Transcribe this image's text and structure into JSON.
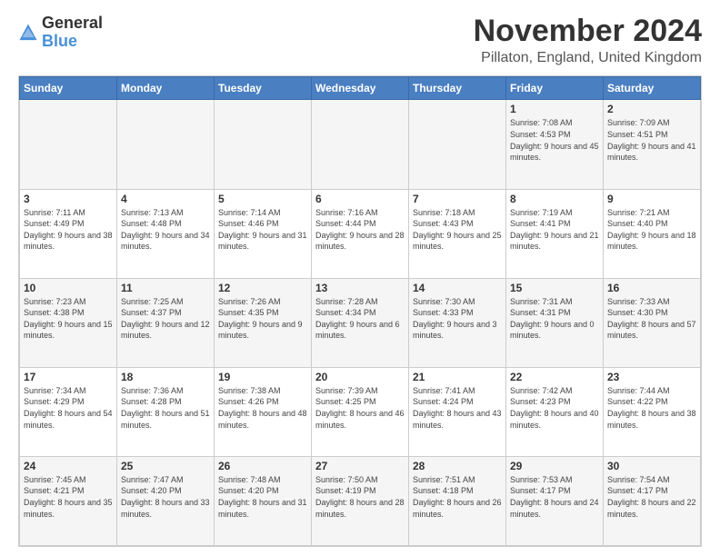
{
  "logo": {
    "general": "General",
    "blue": "Blue"
  },
  "title": "November 2024",
  "location": "Pillaton, England, United Kingdom",
  "days_header": [
    "Sunday",
    "Monday",
    "Tuesday",
    "Wednesday",
    "Thursday",
    "Friday",
    "Saturday"
  ],
  "weeks": [
    [
      {
        "day": "",
        "info": ""
      },
      {
        "day": "",
        "info": ""
      },
      {
        "day": "",
        "info": ""
      },
      {
        "day": "",
        "info": ""
      },
      {
        "day": "",
        "info": ""
      },
      {
        "day": "1",
        "info": "Sunrise: 7:08 AM\nSunset: 4:53 PM\nDaylight: 9 hours and 45 minutes."
      },
      {
        "day": "2",
        "info": "Sunrise: 7:09 AM\nSunset: 4:51 PM\nDaylight: 9 hours and 41 minutes."
      }
    ],
    [
      {
        "day": "3",
        "info": "Sunrise: 7:11 AM\nSunset: 4:49 PM\nDaylight: 9 hours and 38 minutes."
      },
      {
        "day": "4",
        "info": "Sunrise: 7:13 AM\nSunset: 4:48 PM\nDaylight: 9 hours and 34 minutes."
      },
      {
        "day": "5",
        "info": "Sunrise: 7:14 AM\nSunset: 4:46 PM\nDaylight: 9 hours and 31 minutes."
      },
      {
        "day": "6",
        "info": "Sunrise: 7:16 AM\nSunset: 4:44 PM\nDaylight: 9 hours and 28 minutes."
      },
      {
        "day": "7",
        "info": "Sunrise: 7:18 AM\nSunset: 4:43 PM\nDaylight: 9 hours and 25 minutes."
      },
      {
        "day": "8",
        "info": "Sunrise: 7:19 AM\nSunset: 4:41 PM\nDaylight: 9 hours and 21 minutes."
      },
      {
        "day": "9",
        "info": "Sunrise: 7:21 AM\nSunset: 4:40 PM\nDaylight: 9 hours and 18 minutes."
      }
    ],
    [
      {
        "day": "10",
        "info": "Sunrise: 7:23 AM\nSunset: 4:38 PM\nDaylight: 9 hours and 15 minutes."
      },
      {
        "day": "11",
        "info": "Sunrise: 7:25 AM\nSunset: 4:37 PM\nDaylight: 9 hours and 12 minutes."
      },
      {
        "day": "12",
        "info": "Sunrise: 7:26 AM\nSunset: 4:35 PM\nDaylight: 9 hours and 9 minutes."
      },
      {
        "day": "13",
        "info": "Sunrise: 7:28 AM\nSunset: 4:34 PM\nDaylight: 9 hours and 6 minutes."
      },
      {
        "day": "14",
        "info": "Sunrise: 7:30 AM\nSunset: 4:33 PM\nDaylight: 9 hours and 3 minutes."
      },
      {
        "day": "15",
        "info": "Sunrise: 7:31 AM\nSunset: 4:31 PM\nDaylight: 9 hours and 0 minutes."
      },
      {
        "day": "16",
        "info": "Sunrise: 7:33 AM\nSunset: 4:30 PM\nDaylight: 8 hours and 57 minutes."
      }
    ],
    [
      {
        "day": "17",
        "info": "Sunrise: 7:34 AM\nSunset: 4:29 PM\nDaylight: 8 hours and 54 minutes."
      },
      {
        "day": "18",
        "info": "Sunrise: 7:36 AM\nSunset: 4:28 PM\nDaylight: 8 hours and 51 minutes."
      },
      {
        "day": "19",
        "info": "Sunrise: 7:38 AM\nSunset: 4:26 PM\nDaylight: 8 hours and 48 minutes."
      },
      {
        "day": "20",
        "info": "Sunrise: 7:39 AM\nSunset: 4:25 PM\nDaylight: 8 hours and 46 minutes."
      },
      {
        "day": "21",
        "info": "Sunrise: 7:41 AM\nSunset: 4:24 PM\nDaylight: 8 hours and 43 minutes."
      },
      {
        "day": "22",
        "info": "Sunrise: 7:42 AM\nSunset: 4:23 PM\nDaylight: 8 hours and 40 minutes."
      },
      {
        "day": "23",
        "info": "Sunrise: 7:44 AM\nSunset: 4:22 PM\nDaylight: 8 hours and 38 minutes."
      }
    ],
    [
      {
        "day": "24",
        "info": "Sunrise: 7:45 AM\nSunset: 4:21 PM\nDaylight: 8 hours and 35 minutes."
      },
      {
        "day": "25",
        "info": "Sunrise: 7:47 AM\nSunset: 4:20 PM\nDaylight: 8 hours and 33 minutes."
      },
      {
        "day": "26",
        "info": "Sunrise: 7:48 AM\nSunset: 4:20 PM\nDaylight: 8 hours and 31 minutes."
      },
      {
        "day": "27",
        "info": "Sunrise: 7:50 AM\nSunset: 4:19 PM\nDaylight: 8 hours and 28 minutes."
      },
      {
        "day": "28",
        "info": "Sunrise: 7:51 AM\nSunset: 4:18 PM\nDaylight: 8 hours and 26 minutes."
      },
      {
        "day": "29",
        "info": "Sunrise: 7:53 AM\nSunset: 4:17 PM\nDaylight: 8 hours and 24 minutes."
      },
      {
        "day": "30",
        "info": "Sunrise: 7:54 AM\nSunset: 4:17 PM\nDaylight: 8 hours and 22 minutes."
      }
    ]
  ]
}
